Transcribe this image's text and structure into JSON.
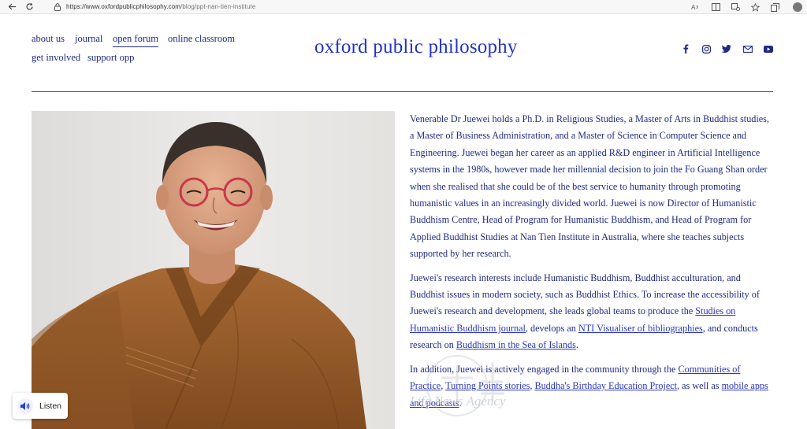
{
  "browser": {
    "url_host": "https://www.oxfordpublicphilosophy.com",
    "url_path": "/blog/ppt-nan-tien-institute"
  },
  "header": {
    "nav": [
      {
        "label": "about us",
        "active": false
      },
      {
        "label": "journal",
        "active": false
      },
      {
        "label": "open forum",
        "active": true
      },
      {
        "label": "online classroom",
        "active": false
      },
      {
        "label": "get involved",
        "active": false
      },
      {
        "label": "support opp",
        "active": false
      }
    ],
    "site_title": "oxford public philosophy",
    "social_icons": [
      "facebook-icon",
      "instagram-icon",
      "twitter-icon",
      "mail-icon",
      "youtube-icon"
    ]
  },
  "article": {
    "p1": "Venerable Dr Juewei holds a Ph.D. in Religious Studies, a Master of Arts in Buddhist studies, a Master of Business Administration, and a Master of Science in Computer Science and Engineering. Juewei began her career as an applied R&D engineer in Artificial Intelligence systems in the 1980s, however made her millennial decision to join the Fo Guang Shan order when she realised that she could be of the best service to humanity through promoting humanistic values in an increasingly divided world. Juewei is now Director of Humanistic Buddhism Centre, Head of Program for Humanistic Buddhism, and Head of Program for Applied Buddhist Studies at Nan Tien Institute in Australia, where she teaches subjects supported by her research.",
    "p2_a": "Juewei's research interests include Humanistic Buddhism, Buddhist acculturation, and Buddhist issues in modern society, such as Buddhist Ethics. To increase the accessibility of Juewei's research and development, she leads global teams to produce the ",
    "p2_link1": "Studies on Humanistic Buddhism journal",
    "p2_b": ", develops an ",
    "p2_link2": "NTI Visualiser of bibliographies",
    "p2_c": ", and conducts research on ",
    "p2_link3": "Buddhism in the Sea of Islands",
    "p2_d": ".",
    "p3_a": "In addition, Juewei is actively engaged in the community through the ",
    "p3_link1": "Communities of Practice",
    "p3_b": ", ",
    "p3_link2": "Turning Points stories",
    "p3_c": ", ",
    "p3_link3": "Buddha's Birthday Education Project",
    "p3_d": ", as well as ",
    "p3_link4": "mobile apps and podcasts",
    "p3_e": "."
  },
  "watermark": {
    "text": "Life News Agency"
  },
  "listen_widget": {
    "label": "Listen"
  },
  "colors": {
    "brand_blue": "#2233c9",
    "nav_text": "#1f2a86",
    "robe": "#9a5a28"
  }
}
